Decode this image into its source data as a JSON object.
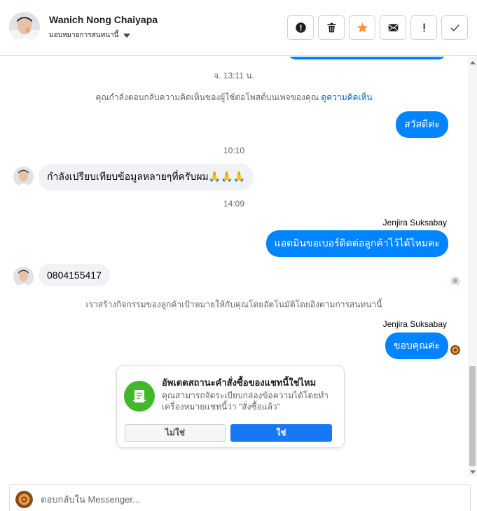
{
  "header": {
    "contact_name": "Wanich Nong Chaiyapa",
    "assign_label": "มอบหมายการสนทนานี้",
    "actions": [
      {
        "icon": "alert-circle-icon",
        "name": "spam-button"
      },
      {
        "icon": "trash-icon",
        "name": "delete-button"
      },
      {
        "icon": "star-icon",
        "name": "star-button"
      },
      {
        "icon": "envelope-icon",
        "name": "mark-unread-button"
      },
      {
        "icon": "exclamation-icon",
        "name": "follow-up-button"
      },
      {
        "icon": "check-icon",
        "name": "mark-done-button"
      }
    ]
  },
  "colors": {
    "brand_blue": "#0084ff",
    "button_blue": "#1877f2",
    "star_orange": "#f7923b",
    "success_green": "#42b72a"
  },
  "messages": {
    "ts1": "จ. 13:11 น.",
    "notice1_text": "คุณกำลังตอบกลับความคิดเห็นของผู้ใช้ต่อโพสต์บนเพจของคุณ",
    "notice1_link": "ดูความคิดเห็น",
    "out1": "สวัสดีค่ะ",
    "ts2": "10:10",
    "in1": "กำลังเปรียบเทียบข้อมูลหลายๆที่ครับผม🙏🙏🙏",
    "ts3": "14:09",
    "sender1": "Jenjira Suksabay",
    "out2": "แอดมินขอเบอร์ติดต่อลูกค้าไว้ได้ไหมคะ",
    "in2": "0804155417",
    "notice2": "เราสร้างกิจกรรมของลูกค้าเป้าหมายให้กับคุณโดยอัตโนมัติโดยอิงตามการสนทนานี้",
    "sender2": "Jenjira Suksabay",
    "out3": "ขอบคุณค่ะ"
  },
  "update_card": {
    "title": "อัพเดตสถานะคำสั่งซื้อของแชทนี้ใช่ไหม",
    "body": "คุณสามารถจัดระเบียบกล่องข้อความได้โดยทำเครื่องหมายแชทนี้ว่า \"สั่งซื้อแล้ว\"",
    "no_label": "ไม่ใช่",
    "yes_label": "ใช่"
  },
  "composer": {
    "placeholder": "ตอบกลับใน Messenger..."
  }
}
